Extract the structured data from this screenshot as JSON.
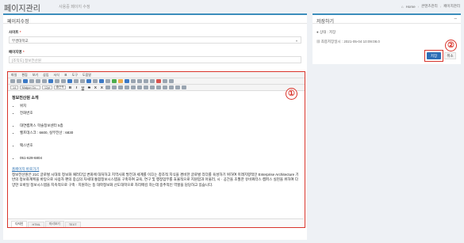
{
  "header": {
    "title": "페이지관리",
    "subtitle": "사용중 페이지 수정",
    "breadcrumbs": [
      "Home",
      "콘텐츠관리",
      "페이지관리"
    ]
  },
  "edit_panel": {
    "title": "페이지수정",
    "site_label": "사이트",
    "site_value": "부경대학교",
    "page_name_label": "페이지명",
    "page_name_value": "[조직도] 정보전산원",
    "content_label": "콘텐츠",
    "required_mark": "*"
  },
  "editor": {
    "menus": [
      "파일",
      "편집",
      "보기",
      "삽입",
      "서식",
      "표",
      "도구",
      "도움말"
    ],
    "font_size": "14",
    "font_name": "Malgun Go...",
    "size_select": "12pt",
    "format_select": "줄간격",
    "heading": "정보전산원 소개",
    "list1": [
      "위치",
      "전화번호"
    ],
    "list2": [
      "대연캠퍼스 학술정보센터 5층",
      "헬프데스크 : 6600, 실무전산 : 6830"
    ],
    "list3": [
      "팩스번호"
    ],
    "list4": [
      "051-629-6804"
    ],
    "link_text": "홈페이지 바로가기",
    "paragraph": "정보전산원은 21C 글로벌 시대의 정보화 패러다임 변화에 대처하고 지역사회 발전과 세계를 이끄는 창조적 지식을 겸비한 글로벌 리더를 육성하기 위하여 미래지향적인 Enterprise Architecture 기반의 정보화계획을 바탕으로 사용자 편의 중심의 차세대 통합정보시스템을 구축하여 교육, 연구 및 행정업무를 효율적으로 지원함과 아울러, 시 · 공간을 초월한 유비쿼터스 캠퍼스 실현을 위하여 다양한 모바일 정보시스템을 지속적으로 구축 · 지원하는 등 대학정보화 선도대학으로 자리매김 하는데 중추적인 역할을 담당하고 있습니다.",
    "tabs": [
      "다지인",
      "HTML",
      "미리보기",
      "TEXT"
    ]
  },
  "save_panel": {
    "title": "저장하기",
    "status_label": "상태 : 저장",
    "updated_label": "최종저장일시 : 2021-05-04 10:09:08.0",
    "save_button": "저장",
    "cancel_button": "취소",
    "collapse_icon": "minus-icon"
  },
  "annotations": [
    "①",
    "②"
  ],
  "colors": {
    "accent": "#3c8dbc",
    "primary_button": "#2d6db5",
    "highlight": "#d9342b"
  }
}
